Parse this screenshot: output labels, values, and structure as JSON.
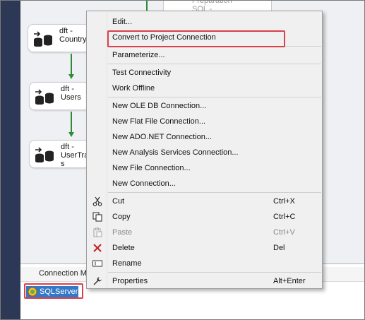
{
  "canvas": {
    "nodes": [
      {
        "label": "dft -\nCountry"
      },
      {
        "label": "dft -\nUsers"
      },
      {
        "label": "dft -\nUserTra\ns"
      }
    ],
    "prep_label": "Preparation\nSQL -"
  },
  "menu": {
    "items": [
      {
        "label": "Edit...",
        "shortcut": "",
        "icon": "",
        "disabled": false
      },
      {
        "label": "Convert to Project Connection",
        "shortcut": "",
        "icon": "",
        "disabled": false
      },
      {
        "label": "Parameterize...",
        "shortcut": "",
        "icon": "",
        "disabled": false
      },
      {
        "label": "Test Connectivity",
        "shortcut": "",
        "icon": "",
        "disabled": false
      },
      {
        "label": "Work Offline",
        "shortcut": "",
        "icon": "",
        "disabled": false
      },
      {
        "label": "New OLE DB Connection...",
        "shortcut": "",
        "icon": "",
        "disabled": false
      },
      {
        "label": "New Flat File Connection...",
        "shortcut": "",
        "icon": "",
        "disabled": false
      },
      {
        "label": "New ADO.NET Connection...",
        "shortcut": "",
        "icon": "",
        "disabled": false
      },
      {
        "label": "New Analysis Services Connection...",
        "shortcut": "",
        "icon": "",
        "disabled": false
      },
      {
        "label": "New File Connection...",
        "shortcut": "",
        "icon": "",
        "disabled": false
      },
      {
        "label": "New Connection...",
        "shortcut": "",
        "icon": "",
        "disabled": false
      },
      {
        "label": "Cut",
        "shortcut": "Ctrl+X",
        "icon": "scissors-icon",
        "disabled": false
      },
      {
        "label": "Copy",
        "shortcut": "Ctrl+C",
        "icon": "copy-icon",
        "disabled": false
      },
      {
        "label": "Paste",
        "shortcut": "Ctrl+V",
        "icon": "paste-icon",
        "disabled": true
      },
      {
        "label": "Delete",
        "shortcut": "Del",
        "icon": "delete-x-icon",
        "disabled": false
      },
      {
        "label": "Rename",
        "shortcut": "",
        "icon": "rename-icon",
        "disabled": false
      },
      {
        "label": "Properties",
        "shortcut": "Alt+Enter",
        "icon": "wrench-icon",
        "disabled": false
      }
    ]
  },
  "connections": {
    "title": "Connection M",
    "selected": "SQLServer"
  },
  "colors": {
    "highlight": "#d9414a",
    "selection": "#3478c8",
    "precedence": "#2e8b3a"
  }
}
